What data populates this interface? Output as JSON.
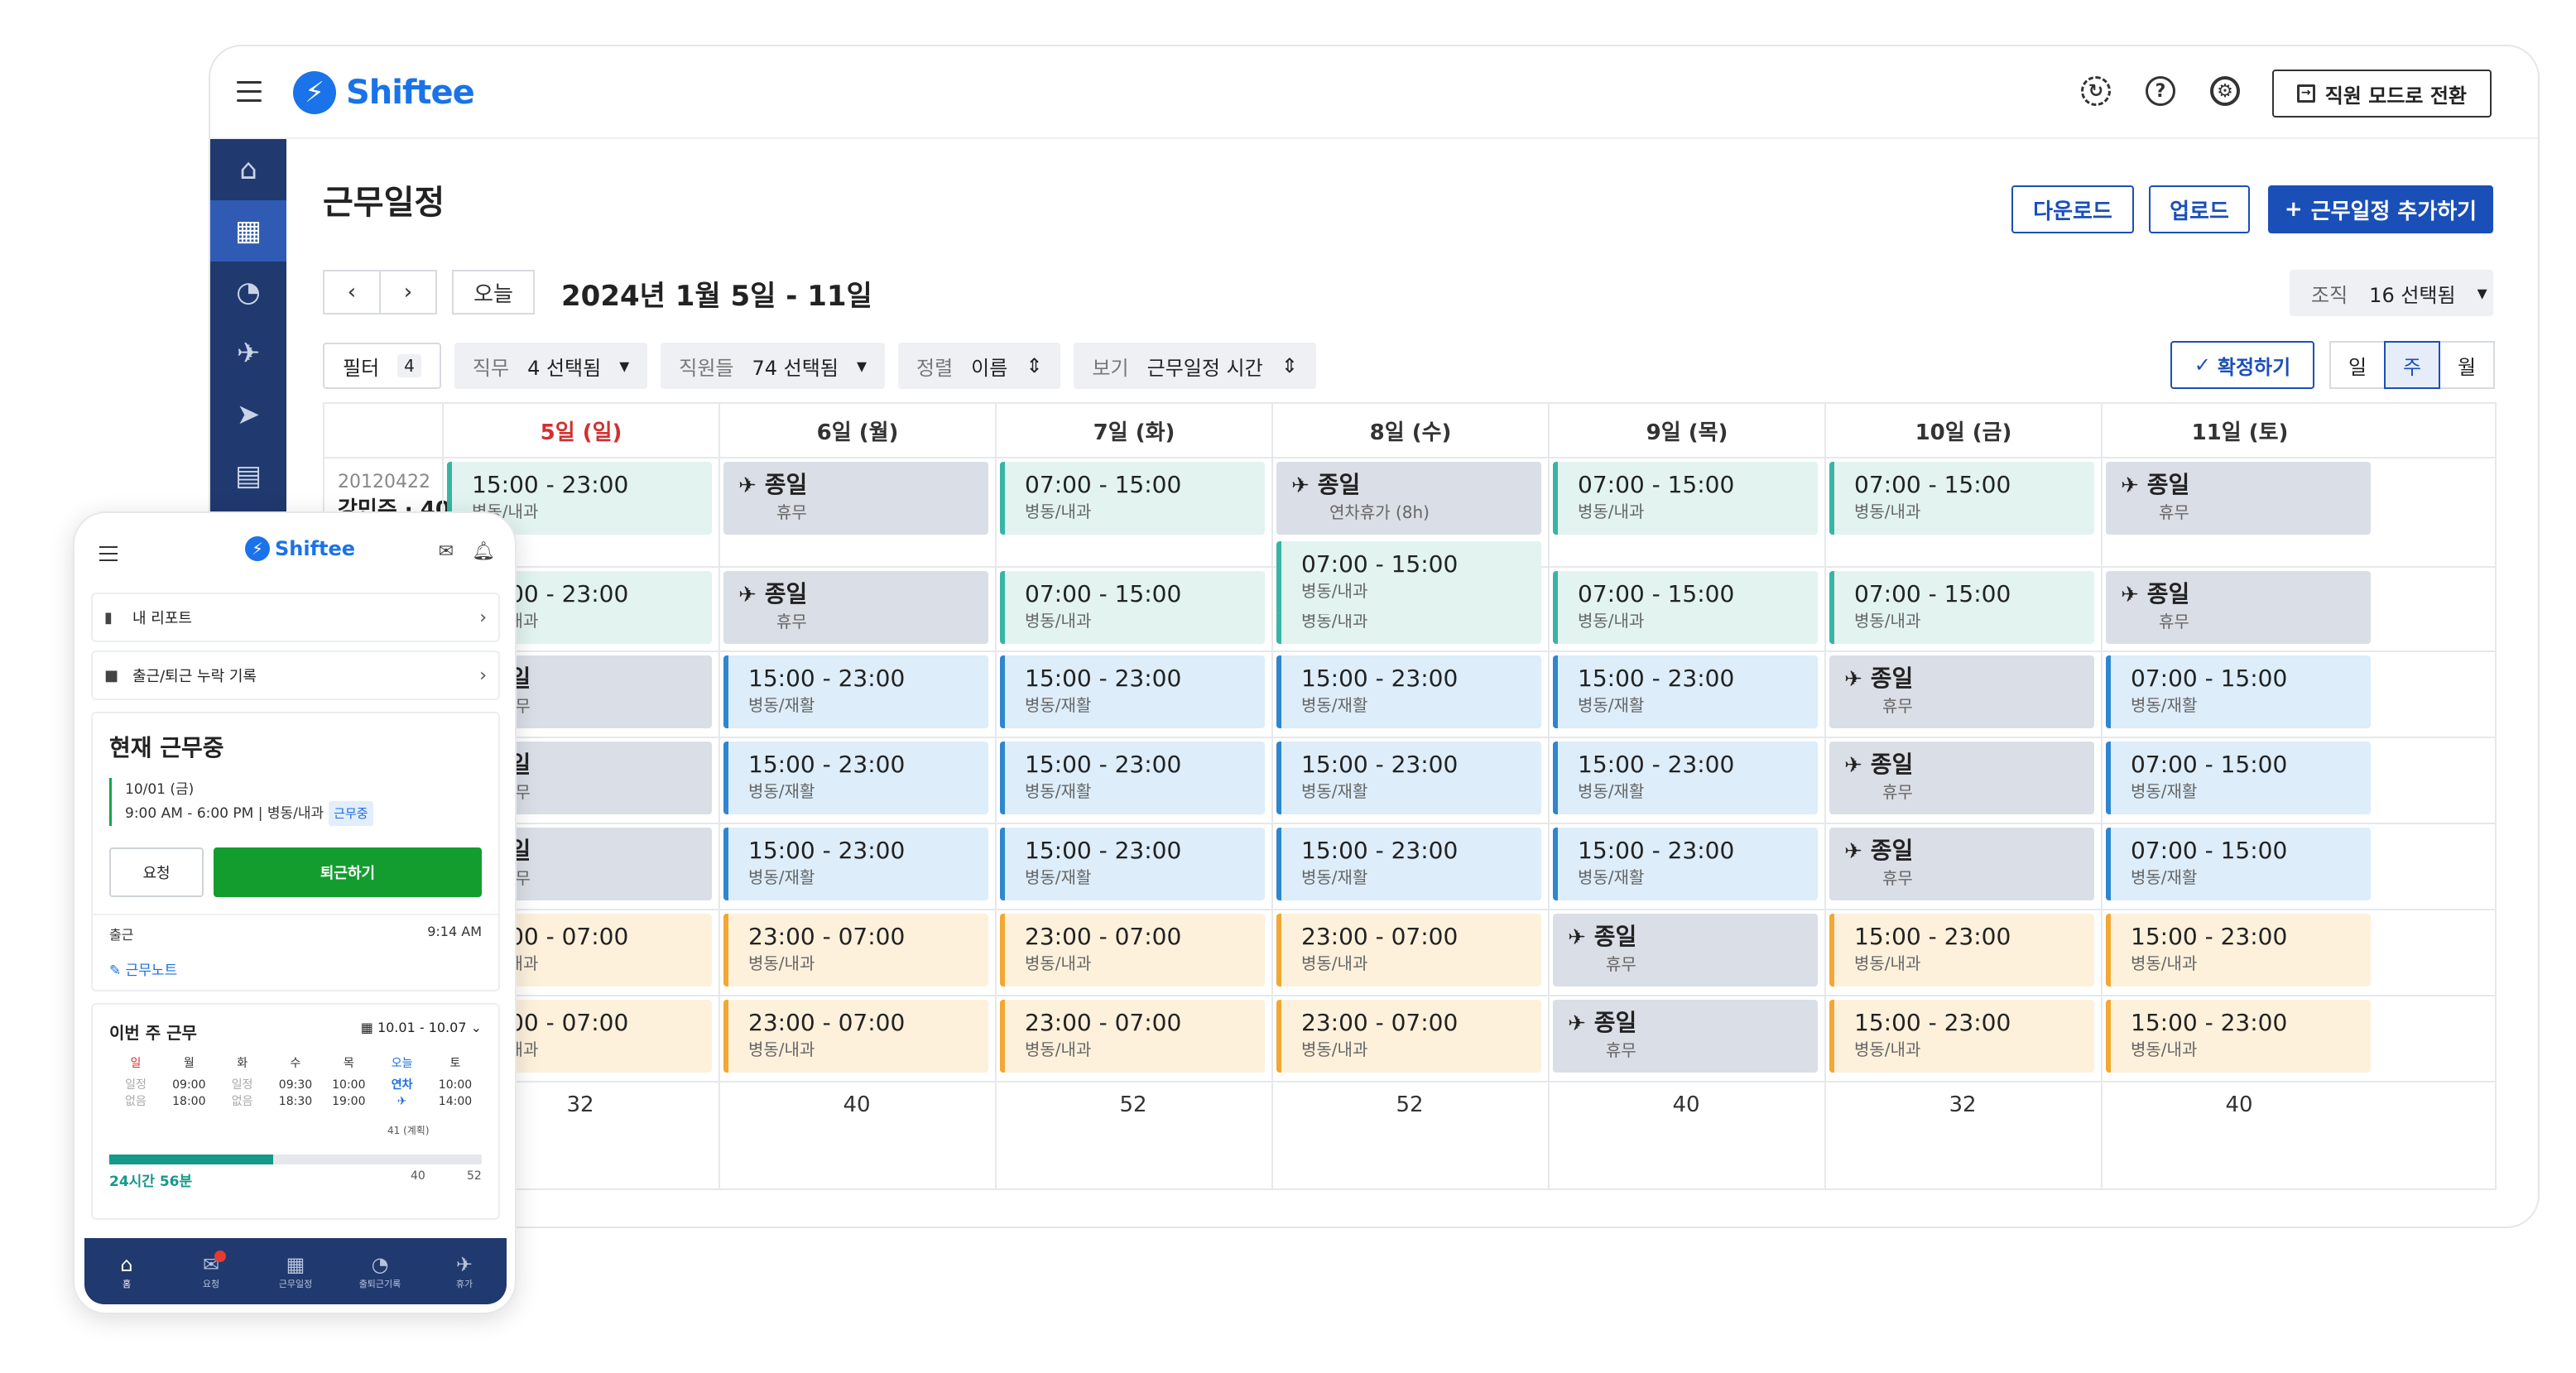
{
  "app": {
    "name": "Shiftee",
    "mode_button": "직원 모드로 전환"
  },
  "page": {
    "title": "근무일정",
    "buttons": {
      "download": "다운로드",
      "upload": "업로드",
      "add": "근무일정 추가하기"
    },
    "nav": {
      "prev": "‹",
      "next": "›",
      "today": "오늘"
    },
    "date_range": "2024년 1월 5일 - 11일",
    "org": {
      "label": "조직",
      "value": "16 선택됨"
    },
    "filters": {
      "filter": {
        "label": "필터",
        "count": "4"
      },
      "job": {
        "label": "직무",
        "value": "4 선택됨"
      },
      "staff": {
        "label": "직원들",
        "value": "74 선택됨"
      },
      "sort": {
        "label": "정렬",
        "value": "이름"
      },
      "view": {
        "label": "보기",
        "value": "근무일정 시간"
      }
    },
    "confirm": "확정하기",
    "view_modes": [
      "일",
      "주",
      "월"
    ],
    "active_view": "주"
  },
  "schedule": {
    "days": [
      "5일 (일)",
      "6일 (월)",
      "7일 (화)",
      "8일 (수)",
      "9일 (목)",
      "10일 (금)",
      "11일 (토)"
    ],
    "employee": {
      "id": "20120422",
      "name": "강민주 · 40h"
    },
    "rows": [
      [
        [
          "green",
          "15:00 - 23:00",
          "병동/내과"
        ],
        [
          "gray",
          "종일",
          "휴무"
        ],
        [
          "green",
          "07:00 - 15:00",
          "병동/내과"
        ],
        [
          "gray",
          "종일",
          "연차휴가 (8h)"
        ],
        [
          "green",
          "07:00 - 15:00",
          "병동/내과"
        ],
        [
          "green",
          "07:00 - 15:00",
          "병동/내과"
        ],
        [
          "gray",
          "종일",
          "휴무"
        ]
      ],
      [
        [
          "green",
          "15:00 - 23:00",
          "병동/내과"
        ],
        [
          "gray",
          "종일",
          "휴무"
        ],
        [
          "green",
          "07:00 - 15:00",
          "병동/내과"
        ],
        [
          "green",
          "07:00 - 15:00",
          "병동/내과"
        ],
        [
          "green",
          "07:00 - 15:00",
          "병동/내과"
        ],
        [
          "green",
          "07:00 - 15:00",
          "병동/내과"
        ],
        [
          "gray",
          "종일",
          "휴무"
        ]
      ],
      [
        [
          "gray",
          "종일",
          "휴무"
        ],
        [
          "blue",
          "15:00 - 23:00",
          "병동/재활"
        ],
        [
          "blue",
          "15:00 - 23:00",
          "병동/재활"
        ],
        [
          "blue",
          "15:00 - 23:00",
          "병동/재활"
        ],
        [
          "blue",
          "15:00 - 23:00",
          "병동/재활"
        ],
        [
          "gray",
          "종일",
          "휴무"
        ],
        [
          "blue",
          "07:00 - 15:00",
          "병동/재활"
        ]
      ],
      [
        [
          "gray",
          "종일",
          "휴무"
        ],
        [
          "blue",
          "15:00 - 23:00",
          "병동/재활"
        ],
        [
          "blue",
          "15:00 - 23:00",
          "병동/재활"
        ],
        [
          "blue",
          "15:00 - 23:00",
          "병동/재활"
        ],
        [
          "blue",
          "15:00 - 23:00",
          "병동/재활"
        ],
        [
          "gray",
          "종일",
          "휴무"
        ],
        [
          "blue",
          "07:00 - 15:00",
          "병동/재활"
        ]
      ],
      [
        [
          "gray",
          "종일",
          "휴무"
        ],
        [
          "blue",
          "15:00 - 23:00",
          "병동/재활"
        ],
        [
          "blue",
          "15:00 - 23:00",
          "병동/재활"
        ],
        [
          "blue",
          "15:00 - 23:00",
          "병동/재활"
        ],
        [
          "blue",
          "15:00 - 23:00",
          "병동/재활"
        ],
        [
          "gray",
          "종일",
          "휴무"
        ],
        [
          "blue",
          "07:00 - 15:00",
          "병동/재활"
        ]
      ],
      [
        [
          "orange",
          "23:00 - 07:00",
          "병동/내과"
        ],
        [
          "orange",
          "23:00 - 07:00",
          "병동/내과"
        ],
        [
          "orange",
          "23:00 - 07:00",
          "병동/내과"
        ],
        [
          "orange",
          "23:00 - 07:00",
          "병동/내과"
        ],
        [
          "gray",
          "종일",
          "휴무"
        ],
        [
          "orange",
          "15:00 - 23:00",
          "병동/내과"
        ],
        [
          "orange",
          "15:00 - 23:00",
          "병동/내과"
        ]
      ],
      [
        [
          "orange",
          "23:00 - 07:00",
          "병동/내과"
        ],
        [
          "orange",
          "23:00 - 07:00",
          "병동/내과"
        ],
        [
          "orange",
          "23:00 - 07:00",
          "병동/내과"
        ],
        [
          "orange",
          "23:00 - 07:00",
          "병동/내과"
        ],
        [
          "gray",
          "종일",
          "휴무"
        ],
        [
          "orange",
          "15:00 - 23:00",
          "병동/내과"
        ],
        [
          "orange",
          "15:00 - 23:00",
          "병동/내과"
        ]
      ]
    ],
    "extra_shift": [
      "green",
      "07:00 - 15:00",
      "병동/내과"
    ],
    "totals": [
      "32",
      "40",
      "52",
      "52",
      "40",
      "32",
      "40"
    ]
  },
  "mobile": {
    "logo": "Shiftee",
    "my_report": "내 리포트",
    "missing_record": "출근/퇴근 누락 기록",
    "current": {
      "title": "현재 근무중",
      "date": "10/01 (금)",
      "time": "9:00 AM - 6:00 PM | 병동/내과",
      "status": "근무중",
      "request": "요청",
      "clock_out": "퇴근하기",
      "clock_in_label": "출근",
      "clock_in_time": "9:14 AM",
      "note": "근무노트"
    },
    "week": {
      "title": "이번 주 근무",
      "range": "10.01 - 10.07",
      "days": [
        {
          "n": "일",
          "a": "일정",
          "b": "없음"
        },
        {
          "n": "월",
          "a": "09:00",
          "b": "18:00"
        },
        {
          "n": "화",
          "a": "일정",
          "b": "없음"
        },
        {
          "n": "수",
          "a": "09:30",
          "b": "18:30"
        },
        {
          "n": "목",
          "a": "10:00",
          "b": "19:00"
        },
        {
          "n": "오늘",
          "a": "연차",
          "b": "✈"
        },
        {
          "n": "토",
          "a": "10:00",
          "b": "14:00"
        }
      ],
      "planned": "41 (계획)",
      "worked": "24시간 56분",
      "progress_fraction": 0.44,
      "mark_a": "40",
      "mark_b": "52"
    },
    "nav": [
      "홈",
      "요청",
      "근무일정",
      "출퇴근기록",
      "휴가"
    ]
  }
}
